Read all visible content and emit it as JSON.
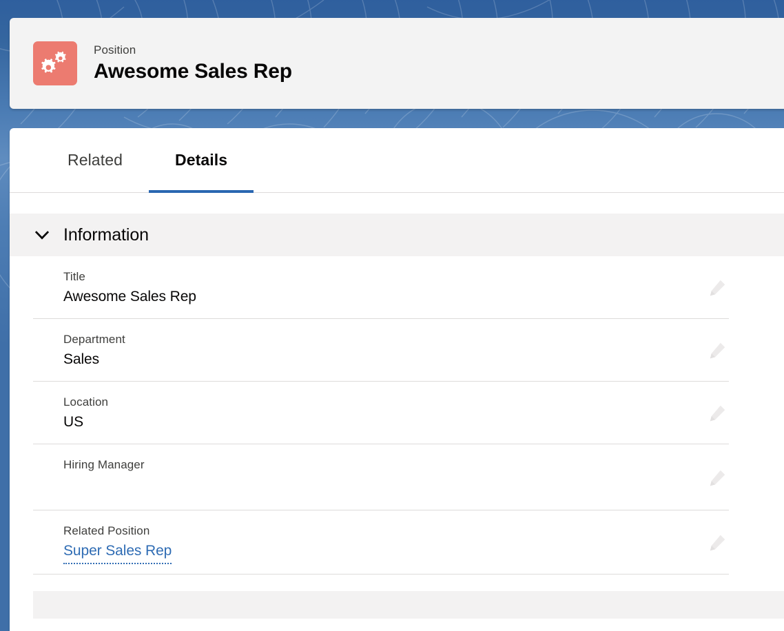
{
  "theme": {
    "background_blue": "#3f6fa8",
    "accent_blue": "#2a67b1",
    "link_blue": "#2f6cb4",
    "icon_badge_color": "#ec7b70",
    "section_header_bg": "#f3f2f2",
    "header_card_bg": "#f3f3f3"
  },
  "header": {
    "icon_name": "cogs-icon",
    "record_type": "Position",
    "record_name": "Awesome Sales Rep"
  },
  "tabs": [
    {
      "label": "Related",
      "active": false
    },
    {
      "label": "Details",
      "active": true
    }
  ],
  "section": {
    "toggle_icon": "chevron-down-icon",
    "title": "Information"
  },
  "fields": [
    {
      "label": "Title",
      "value": "Awesome Sales Rep",
      "is_link": false,
      "empty": false
    },
    {
      "label": "Department",
      "value": "Sales",
      "is_link": false,
      "empty": false
    },
    {
      "label": "Location",
      "value": "US",
      "is_link": false,
      "empty": false
    },
    {
      "label": "Hiring Manager",
      "value": "",
      "is_link": false,
      "empty": true
    },
    {
      "label": "Related Position",
      "value": "Super Sales Rep",
      "is_link": true,
      "empty": false
    }
  ],
  "edit_icon_name": "pencil-icon"
}
